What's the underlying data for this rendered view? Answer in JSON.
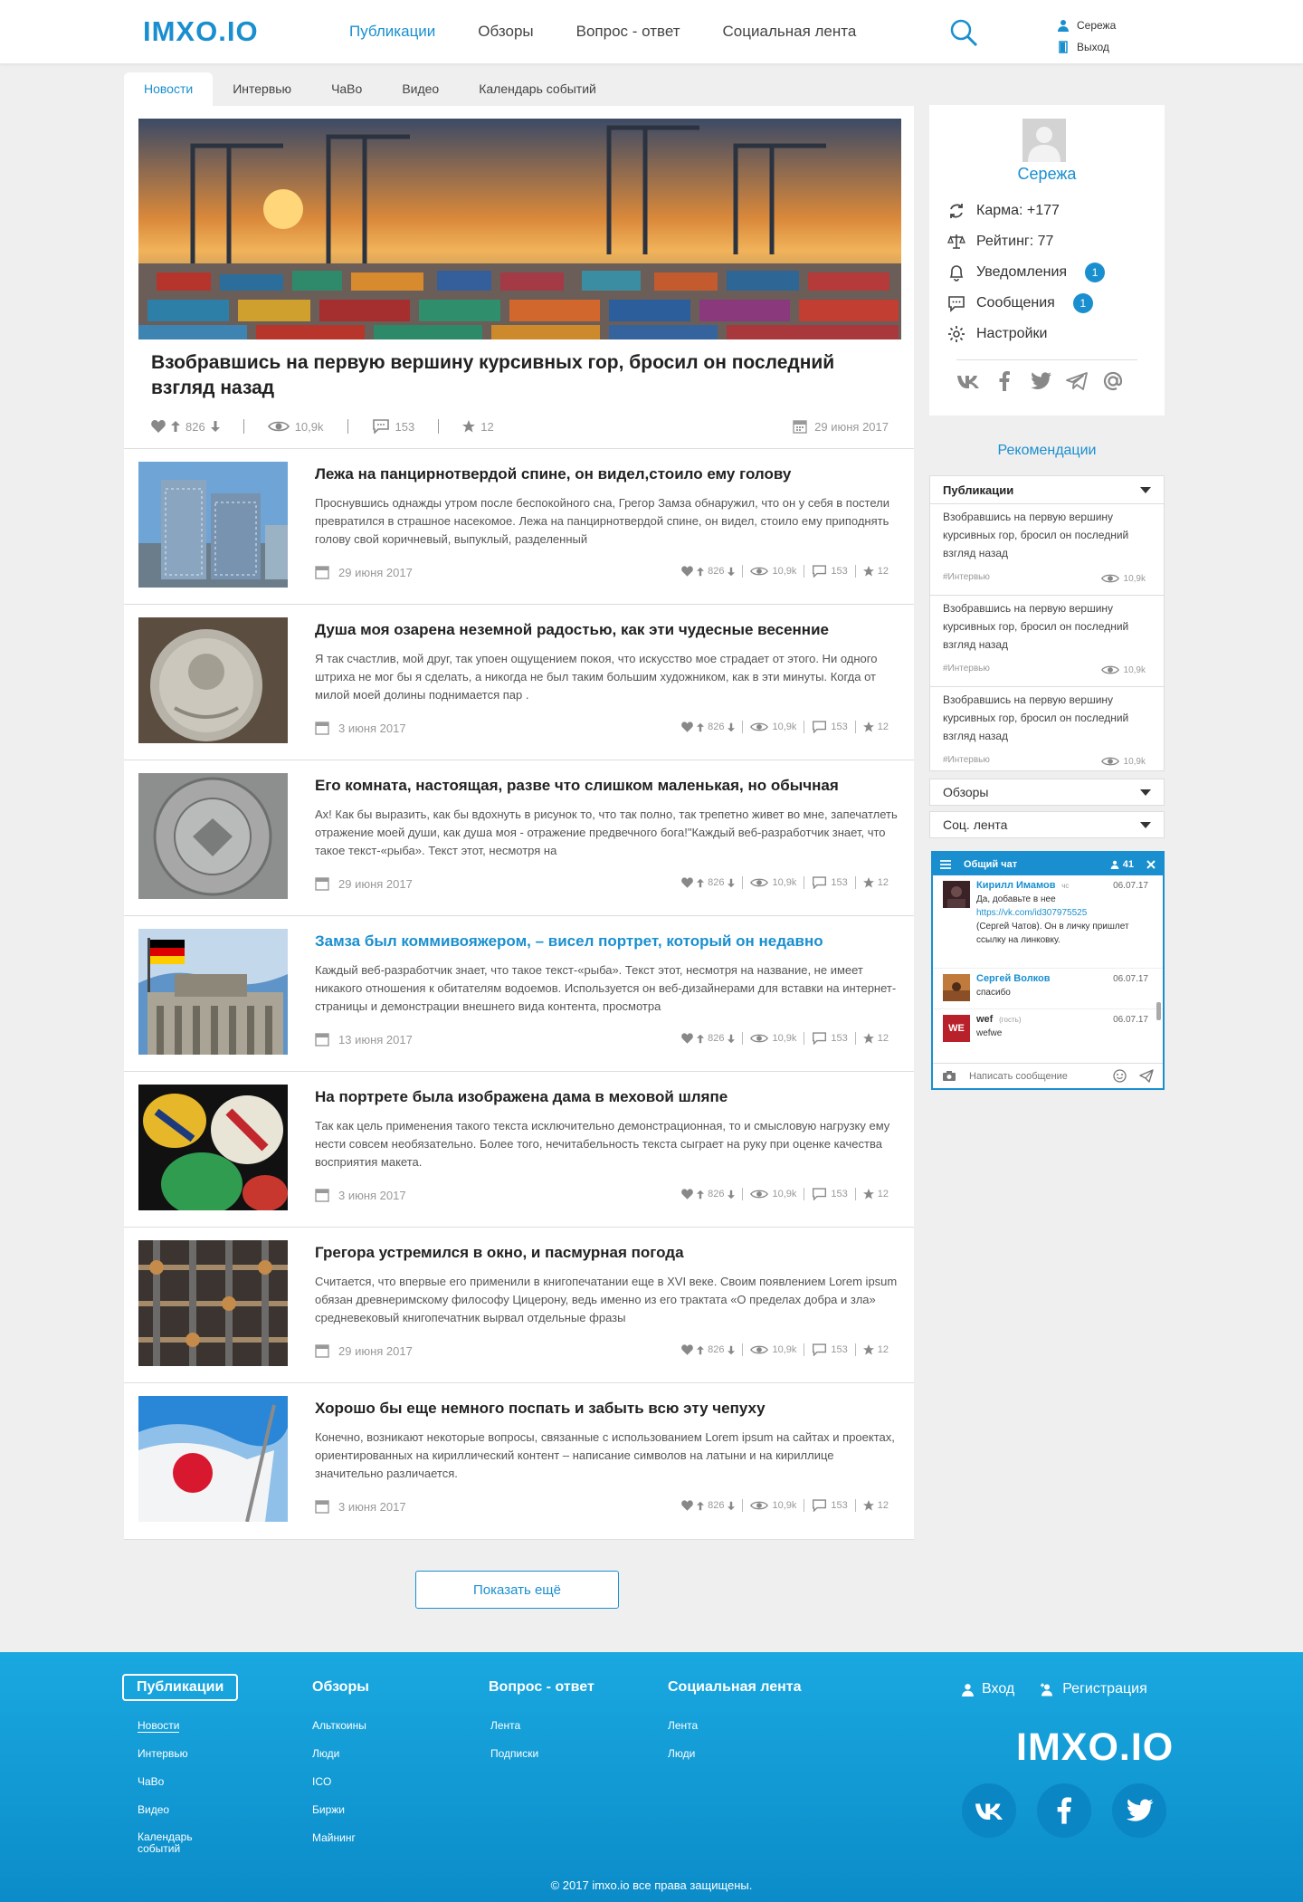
{
  "header": {
    "logo": "IMXO.IO",
    "nav": [
      "Публикации",
      "Обзоры",
      "Вопрос - ответ",
      "Социальная лента"
    ],
    "user_name": "Сережа",
    "logout": "Выход"
  },
  "tabs": [
    "Новости",
    "Интервью",
    "ЧаВо",
    "Видео",
    "Календарь событий"
  ],
  "hero": {
    "title": "Взобравшись на первую вершину курсивных гор, бросил он последний взгляд назад",
    "likes": "826",
    "views": "10,9k",
    "comments": "153",
    "stars": "12",
    "date": "29 июня 2017"
  },
  "articles": [
    {
      "title": "Лежа на панцирнотвердой спине, он видел,стоило ему голову",
      "text": "Проснувшись однажды утром после беспокойного сна, Грегор Замза обнаружил, что он у себя в постели превратился в страшное насекомое. Лежа на панцирнотвердой спине, он видел, стоило ему приподнять голову свой коричневый, выпуклый, разделенный",
      "date": "29 июня 2017",
      "likes": "826",
      "views": "10,9k",
      "comments": "153",
      "stars": "12"
    },
    {
      "title": "Душа моя озарена неземной радостью, как эти чудесные весенние",
      "text": "Я так счастлив, мой друг, так упоен ощущением покоя, что искусство мое страдает от этого. Ни одного штриха не мог бы я сделать, а никогда не был таким большим художником, как в эти минуты. Когда от милой моей долины поднимается пар .",
      "date": "3 июня 2017",
      "likes": "826",
      "views": "10,9k",
      "comments": "153",
      "stars": "12"
    },
    {
      "title": "Его комната, настоящая, разве что слишком маленькая, но обычная",
      "text": "Ах! Как бы выразить, как бы вдохнуть в рисунок то, что так полно, так трепетно живет во мне, запечатлеть отражение моей души, как душа моя - отражение предвечного бога!\"Каждый веб-разработчик знает, что такое текст-«рыба». Текст этот, несмотря на",
      "date": "29 июня 2017",
      "likes": "826",
      "views": "10,9k",
      "comments": "153",
      "stars": "12"
    },
    {
      "title": "Замза был коммивояжером, – висел портрет, который он недавно",
      "text": "Каждый веб-разработчик знает, что такое текст-«рыба». Текст этот, несмотря на название, не имеет никакого отношения к обитателям водоемов. Используется он веб-дизайнерами для вставки на интернет-страницы и демонстрации внешнего вида контента, просмотра",
      "date": "13 июня 2017",
      "likes": "826",
      "views": "10,9k",
      "comments": "153",
      "stars": "12"
    },
    {
      "title": "На портрете была изображена дама в меховой шляпе",
      "text": "Так как цель применения такого текста исключительно демонстрационная, то и смысловую нагрузку ему нести совсем необязательно. Более того, нечитабельность текста сыграет на руку при оценке качества восприятия макета.",
      "date": "3 июня 2017",
      "likes": "826",
      "views": "10,9k",
      "comments": "153",
      "stars": "12"
    },
    {
      "title": "Грегора устремился в окно, и пасмурная погода",
      "text": "Считается, что впервые его применили в книгопечатании еще в XVI веке. Своим появлением Lorem ipsum обязан древнеримскому философу Цицерону, ведь именно из его трактата «О пределах добра и зла» средневековый книгопечатник вырвал отдельные фразы",
      "date": "29 июня 2017",
      "likes": "826",
      "views": "10,9k",
      "comments": "153",
      "stars": "12"
    },
    {
      "title": "Хорошо бы еще немного поспать и забыть всю эту чепуху",
      "text": "Конечно, возникают некоторые вопросы, связанные с использованием Lorem ipsum на сайтах и проектах, ориентированных на кириллический контент – написание символов на латыни и на кириллице значительно различается.",
      "date": "3 июня 2017",
      "likes": "826",
      "views": "10,9k",
      "comments": "153",
      "stars": "12"
    }
  ],
  "more_button": "Показать ещё",
  "profile": {
    "name": "Сережа",
    "karma": "Карма: +177",
    "rating": "Рейтинг: 77",
    "notifications": "Уведомления",
    "notifications_count": "1",
    "messages": "Сообщения",
    "messages_count": "1",
    "settings": "Настройки"
  },
  "recommendations": {
    "title": "Рекомендации",
    "section": "Публикации",
    "items": [
      {
        "text": "Взобравшись на первую вершину курсивных гор, бросил он последний взгляд назад",
        "tag": "#Интервью",
        "views": "10,9k"
      },
      {
        "text": "Взобравшись на первую вершину курсивных гор, бросил он последний взгляд назад",
        "tag": "#Интервью",
        "views": "10,9k"
      },
      {
        "text": "Взобравшись на первую вершину курсивных гор, бросил он последний взгляд назад",
        "tag": "#Интервью",
        "views": "10,9k"
      }
    ],
    "dropdowns": [
      "Обзоры",
      "Соц. лента"
    ]
  },
  "chat": {
    "title": "Общий чат",
    "online": "41",
    "messages": [
      {
        "name": "Кирилл Имамов",
        "status": "чс",
        "time": "06.07.17",
        "line1": "Да, добавьте в нее",
        "link": "https://vk.com/id307975525",
        "line2": "(Сергей Чатов). Он в личку пришлет ссылку на линковку."
      },
      {
        "name": "Сергей Волков",
        "time": "06.07.17",
        "line1": "спасибо"
      },
      {
        "name": "wef",
        "status": "(гость)",
        "time": "06.07.17",
        "line1": "wefwe",
        "avatar": "WE"
      }
    ],
    "placeholder": "Написать сообщение"
  },
  "footer": {
    "columns": [
      {
        "title": "Публикации",
        "links": [
          "Новости",
          "Интервью",
          "ЧаВо",
          "Видео",
          "Календарь событий"
        ]
      },
      {
        "title": "Обзоры",
        "links": [
          "Альткоины",
          "Люди",
          "ICO",
          "Биржи",
          "Майнинг"
        ]
      },
      {
        "title": "Вопрос - ответ",
        "links": [
          "Лента",
          "Подписки"
        ]
      },
      {
        "title": "Социальная лента",
        "links": [
          "Лента",
          "Люди"
        ]
      }
    ],
    "login": "Вход",
    "register": "Регистрация",
    "logo": "IMXO.IO",
    "copyright": "© 2017 imxo.io все права защищены."
  },
  "colors": {
    "accent": "#1a8fcf",
    "footer": "#0b8cc9",
    "background": "#efefef"
  }
}
